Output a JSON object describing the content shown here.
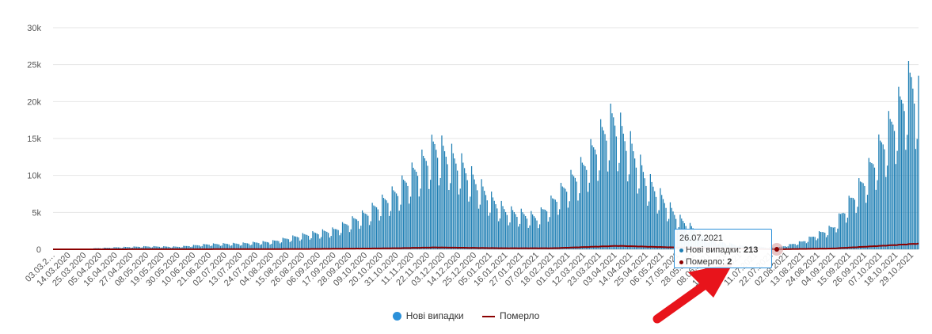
{
  "colors": {
    "cases": "#1f7fb4",
    "deaths": "#8b0000",
    "grid": "#e6e6e6",
    "tooltip_border": "#2b90d9",
    "arrow": "#e8141b"
  },
  "chart_data": {
    "type": "bar",
    "ylim": [
      0,
      30000
    ],
    "y_ticks": [
      {
        "value": 0,
        "label": "0"
      },
      {
        "value": 5000,
        "label": "5k"
      },
      {
        "value": 10000,
        "label": "10k"
      },
      {
        "value": 15000,
        "label": "15k"
      },
      {
        "value": 20000,
        "label": "20k"
      },
      {
        "value": 25000,
        "label": "25k"
      },
      {
        "value": 30000,
        "label": "30k"
      }
    ],
    "x_tick_labels": [
      "03.03.2…",
      "14.03.2020",
      "25.03.2020",
      "05.04.2020",
      "16.04.2020",
      "27.04.2020",
      "08.05.2020",
      "19.05.2020",
      "30.05.2020",
      "10.06.2020",
      "21.06.2020",
      "02.07.2020",
      "13.07.2020",
      "24.07.2020",
      "04.08.2020",
      "15.08.2020",
      "26.08.2020",
      "06.09.2020",
      "17.09.2020",
      "28.09.2020",
      "09.10.2020",
      "20.10.2020",
      "31.10.2020",
      "11.11.2020",
      "22.11.2020",
      "03.12.2020",
      "14.12.2020",
      "25.12.2020",
      "05.01.2021",
      "16.01.2021",
      "27.01.2021",
      "07.02.2021",
      "18.02.2021",
      "01.03.2021",
      "12.03.2021",
      "23.03.2021",
      "03.04.2021",
      "14.04.2021",
      "25.04.2021",
      "06.05.2021",
      "17.05.2021",
      "28.05.2021",
      "08.06.2021",
      "19.06.2021",
      "30.06.2021",
      "11.07.2021",
      "22.07.2021",
      "02.08.2021",
      "13.08.2021",
      "24.08.2021",
      "04.09.2021",
      "15.09.2021",
      "26.09.2021",
      "07.10.2021",
      "18.10.2021",
      "29.10.2021"
    ],
    "x_start": "2020-03-03",
    "x_end": "2021-11-03",
    "series": [
      {
        "name": "Нові випадки",
        "kind": "bar",
        "keyframes": [
          {
            "date": "2020-03-03",
            "value": 0
          },
          {
            "date": "2020-03-25",
            "value": 100
          },
          {
            "date": "2020-04-16",
            "value": 300
          },
          {
            "date": "2020-05-08",
            "value": 450
          },
          {
            "date": "2020-05-30",
            "value": 400
          },
          {
            "date": "2020-06-21",
            "value": 800
          },
          {
            "date": "2020-07-13",
            "value": 900
          },
          {
            "date": "2020-08-04",
            "value": 1200
          },
          {
            "date": "2020-08-26",
            "value": 2200
          },
          {
            "date": "2020-09-17",
            "value": 3000
          },
          {
            "date": "2020-10-09",
            "value": 5500
          },
          {
            "date": "2020-10-31",
            "value": 9000
          },
          {
            "date": "2020-11-22",
            "value": 14500
          },
          {
            "date": "2020-11-27",
            "value": 16200
          },
          {
            "date": "2020-12-14",
            "value": 13500
          },
          {
            "date": "2021-01-05",
            "value": 8000
          },
          {
            "date": "2021-01-16",
            "value": 6000
          },
          {
            "date": "2021-02-07",
            "value": 5000
          },
          {
            "date": "2021-02-18",
            "value": 7500
          },
          {
            "date": "2021-03-12",
            "value": 13000
          },
          {
            "date": "2021-03-25",
            "value": 18000
          },
          {
            "date": "2021-04-02",
            "value": 20300
          },
          {
            "date": "2021-04-14",
            "value": 16000
          },
          {
            "date": "2021-04-25",
            "value": 11000
          },
          {
            "date": "2021-05-17",
            "value": 5000
          },
          {
            "date": "2021-06-08",
            "value": 1500
          },
          {
            "date": "2021-06-30",
            "value": 600
          },
          {
            "date": "2021-07-26",
            "value": 213
          },
          {
            "date": "2021-08-13",
            "value": 1200
          },
          {
            "date": "2021-09-04",
            "value": 3500
          },
          {
            "date": "2021-09-26",
            "value": 11000
          },
          {
            "date": "2021-10-18",
            "value": 21000
          },
          {
            "date": "2021-10-29",
            "value": 26500
          },
          {
            "date": "2021-11-03",
            "value": 23500
          }
        ]
      },
      {
        "name": "Померло",
        "kind": "line",
        "keyframes": [
          {
            "date": "2020-03-03",
            "value": 0
          },
          {
            "date": "2020-05-30",
            "value": 12
          },
          {
            "date": "2020-08-26",
            "value": 40
          },
          {
            "date": "2020-10-31",
            "value": 150
          },
          {
            "date": "2020-11-27",
            "value": 260
          },
          {
            "date": "2021-01-16",
            "value": 150
          },
          {
            "date": "2021-02-18",
            "value": 150
          },
          {
            "date": "2021-04-05",
            "value": 480
          },
          {
            "date": "2021-05-17",
            "value": 250
          },
          {
            "date": "2021-07-26",
            "value": 2
          },
          {
            "date": "2021-09-04",
            "value": 120
          },
          {
            "date": "2021-10-18",
            "value": 600
          },
          {
            "date": "2021-11-03",
            "value": 800
          }
        ]
      }
    ],
    "tooltip": {
      "date": "26.07.2021",
      "cases_label": "Нові випадки: ",
      "cases_value": "213",
      "deaths_label": "Померло: ",
      "deaths_value": "2"
    },
    "legend": [
      {
        "label": "Нові випадки"
      },
      {
        "label": "Померло"
      }
    ]
  }
}
